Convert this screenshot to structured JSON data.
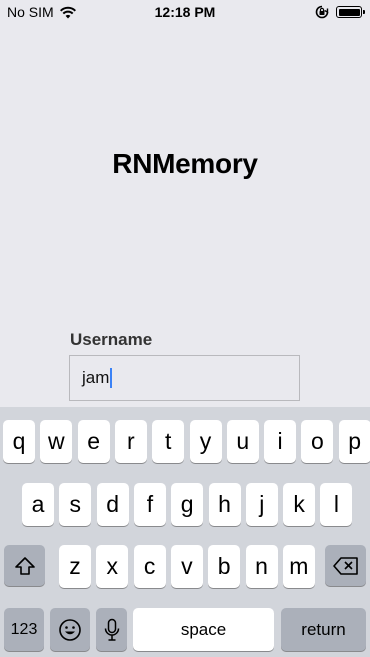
{
  "status_bar": {
    "carrier": "No SIM",
    "time": "12:18 PM",
    "icons": [
      "wifi-icon",
      "orientation-lock-icon",
      "battery-icon"
    ]
  },
  "app": {
    "title": "RNMemory",
    "username_label": "Username",
    "username_value": "jam"
  },
  "keyboard": {
    "row1": [
      "q",
      "w",
      "e",
      "r",
      "t",
      "y",
      "u",
      "i",
      "o",
      "p"
    ],
    "row2": [
      "a",
      "s",
      "d",
      "f",
      "g",
      "h",
      "j",
      "k",
      "l"
    ],
    "row3": [
      "z",
      "x",
      "c",
      "v",
      "b",
      "n",
      "m"
    ],
    "shift_icon": "shift-icon",
    "delete_icon": "delete-icon",
    "numbers_label": "123",
    "emoji_icon": "emoji-icon",
    "mic_icon": "microphone-icon",
    "space_label": "space",
    "return_label": "return"
  }
}
